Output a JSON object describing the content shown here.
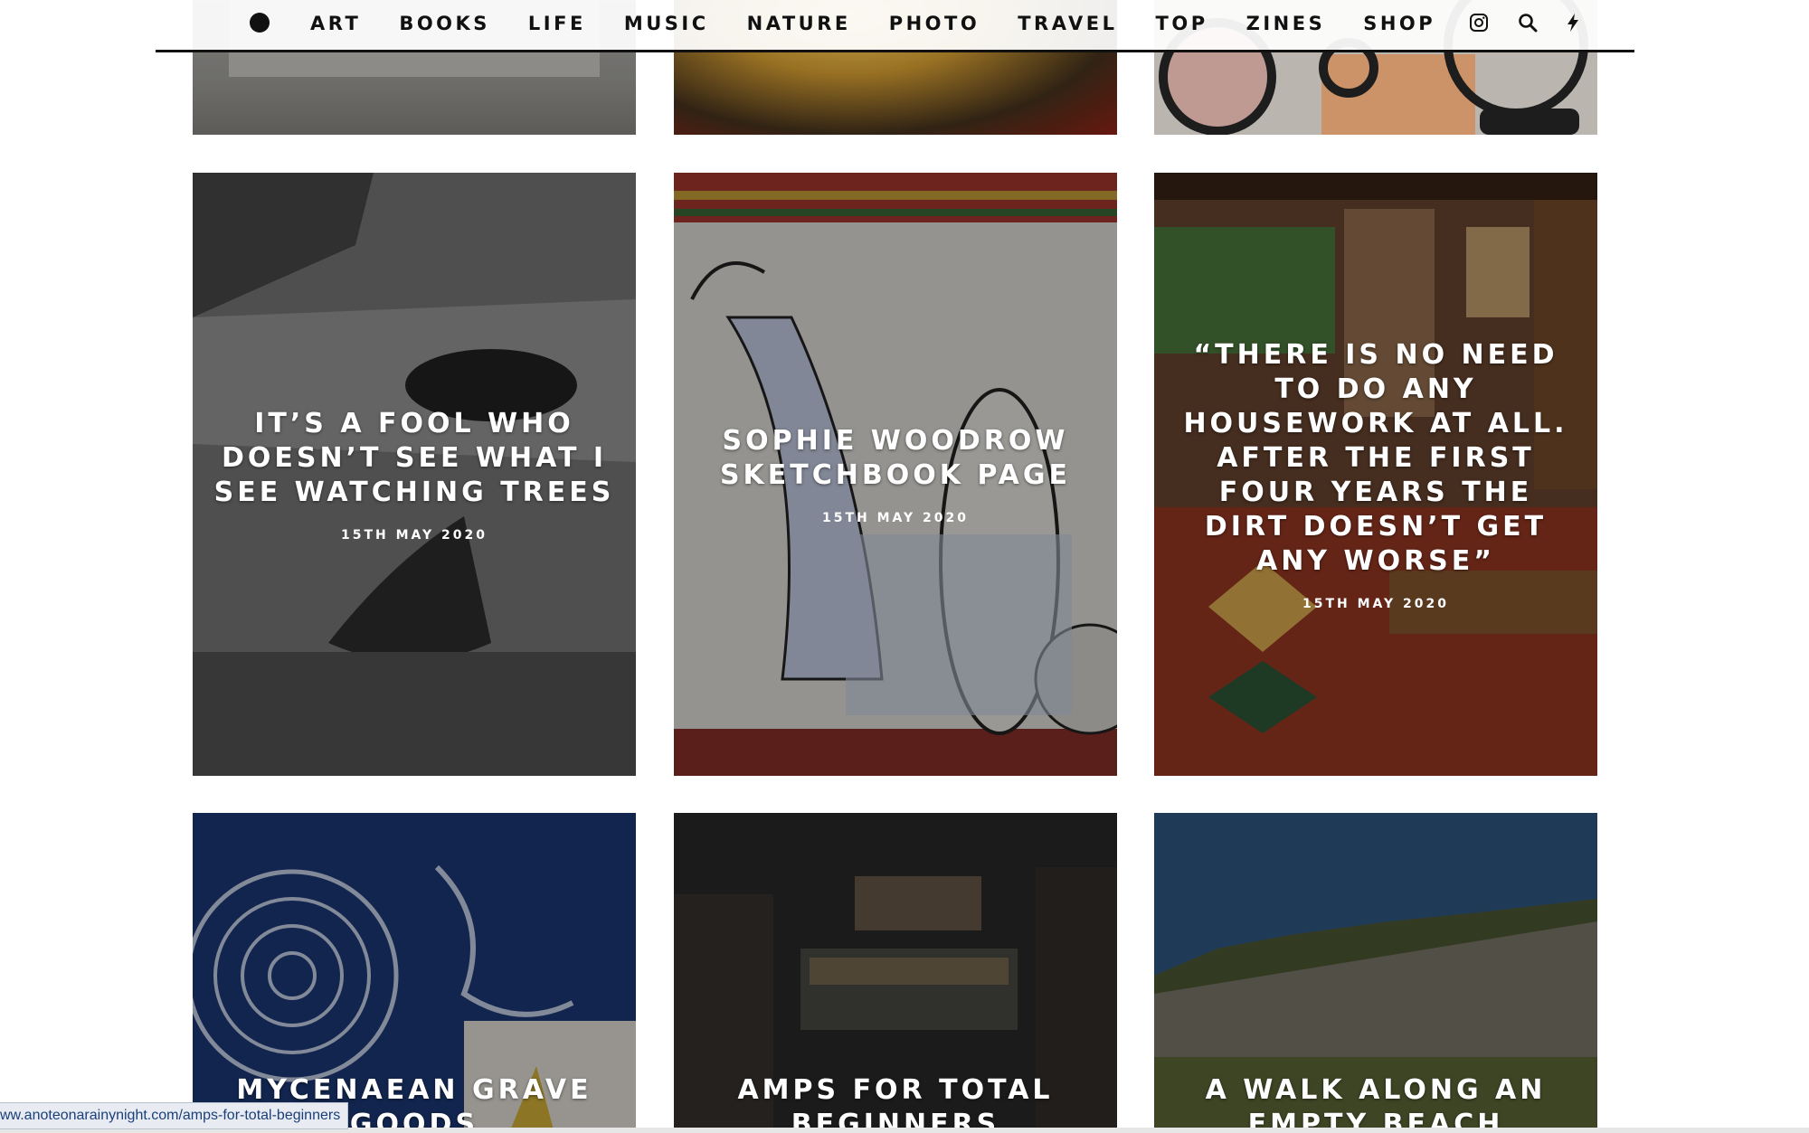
{
  "nav": {
    "items": [
      "ART",
      "BOOKS",
      "LIFE",
      "MUSIC",
      "NATURE",
      "PHOTO",
      "TRAVEL",
      "TOP",
      "ZINES",
      "SHOP"
    ]
  },
  "cards": {
    "mid": [
      {
        "title": "It’s a fool who doesn’t see what I see watching trees",
        "date": "15TH MAY 2020"
      },
      {
        "title": "Sophie Woodrow Sketchbook Page",
        "date": "15TH MAY 2020"
      },
      {
        "title": "“There is no need to do any housework at all. After the first four years the dirt doesn’t get any worse”",
        "date": "15TH MAY 2020"
      }
    ],
    "bottom": [
      {
        "title": "Mycenaean Grave Goods"
      },
      {
        "title": "Amps for total beginners"
      },
      {
        "title": "A walk along an empty beach"
      }
    ]
  },
  "status_bar": {
    "url": "ww.anoteonarainynight.com/amps-for-total-beginners"
  },
  "colors": {
    "text_on_image": "#ffffff",
    "nav_text": "#111111",
    "header_rule": "#111111",
    "status_bg": "#e8ecf2"
  },
  "icons": [
    "logo-dot-icon",
    "instagram-icon",
    "search-icon",
    "bolt-icon"
  ]
}
